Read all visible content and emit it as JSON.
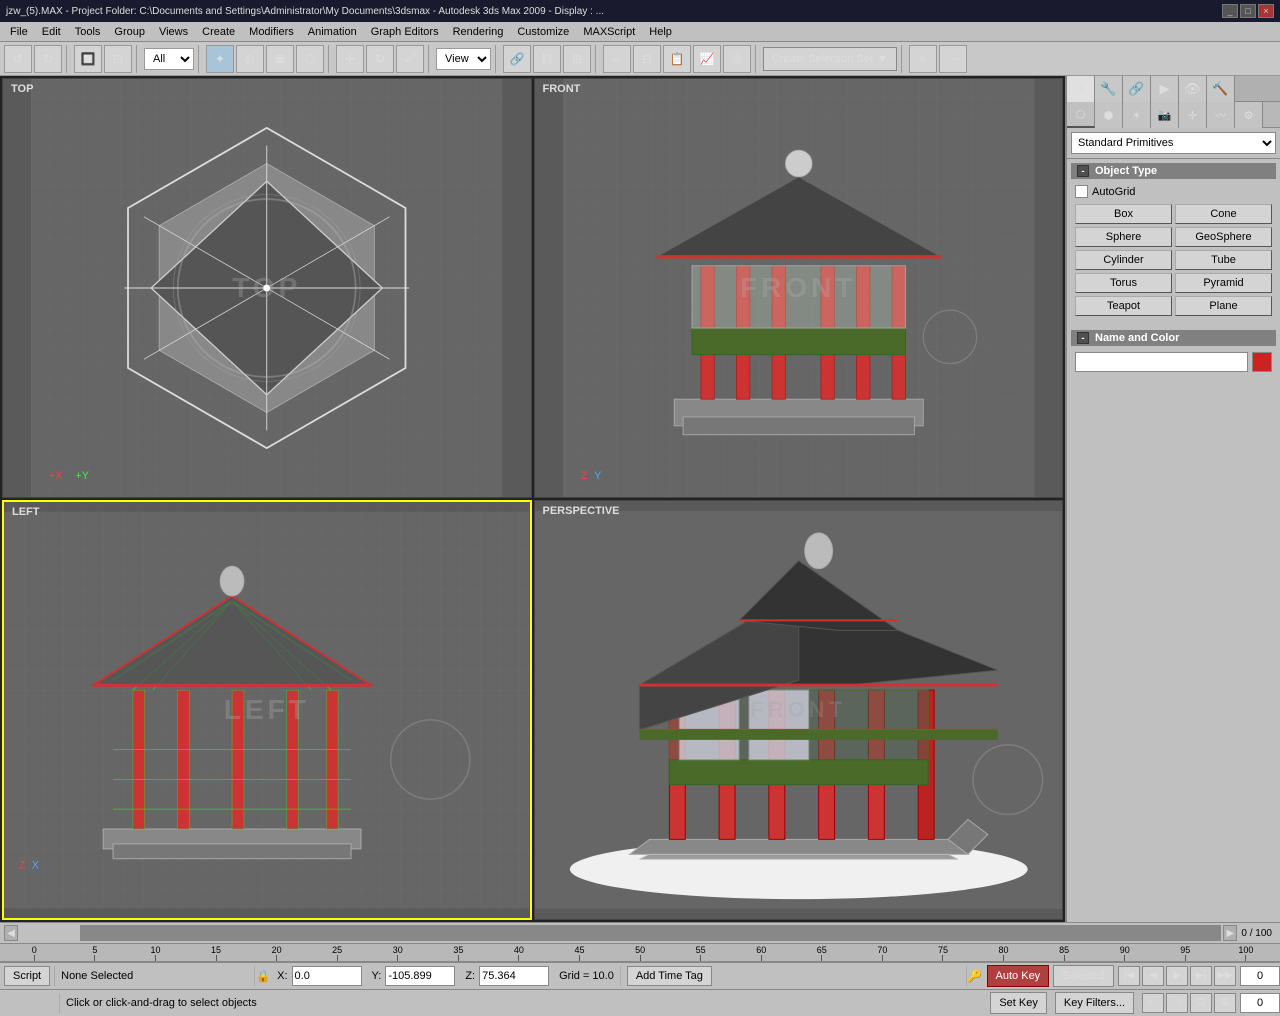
{
  "titlebar": {
    "text": "jzw_(5).MAX - Project Folder: C:\\Documents and Settings\\Administrator\\My Documents\\3dsmax - Autodesk 3ds Max 2009 - Display : ...",
    "win_buttons": [
      "_",
      "□",
      "×"
    ]
  },
  "menubar": {
    "items": [
      "File",
      "Edit",
      "Tools",
      "Group",
      "Views",
      "Create",
      "Modifiers",
      "Animation",
      "Graph Editors",
      "Rendering",
      "Customize",
      "MAXScript",
      "Help"
    ]
  },
  "toolbar": {
    "create_selection_label": "Create Selection Set",
    "filter_label": "All"
  },
  "viewports": [
    {
      "id": "top",
      "label": "Top",
      "watermark": "TOP",
      "active": false
    },
    {
      "id": "front",
      "label": "Front",
      "watermark": "FRONT",
      "active": false
    },
    {
      "id": "left",
      "label": "Left",
      "watermark": "LEFT",
      "active": true
    },
    {
      "id": "perspective",
      "label": "Perspective",
      "watermark": "FRONT",
      "active": false
    }
  ],
  "right_panel": {
    "dropdown_label": "Standard Primitives",
    "object_type_header": "Object Type",
    "autogrid_label": "AutoGrid",
    "buttons": [
      "Box",
      "Cone",
      "Sphere",
      "GeoSphere",
      "Cylinder",
      "Tube",
      "Torus",
      "Pyramid",
      "Teapot",
      "Plane"
    ],
    "name_color_header": "Name and Color",
    "name_placeholder": ""
  },
  "timeline": {
    "progress_label": "0 / 100"
  },
  "ruler": {
    "marks": [
      "0",
      "5",
      "10",
      "15",
      "20",
      "25",
      "30",
      "35",
      "40",
      "45",
      "50",
      "55",
      "60",
      "65",
      "70",
      "75",
      "80",
      "85",
      "90",
      "95",
      "100"
    ]
  },
  "statusbar": {
    "none_selected": "None Selected",
    "x_label": "X:",
    "x_value": "0.0",
    "y_label": "Y:",
    "y_value": "-105.899",
    "z_label": "Z:",
    "z_value": "75.364",
    "grid_label": "Grid = 10.0",
    "auto_key_label": "Auto Key",
    "selected_label": "Selected",
    "set_key_label": "Set Key",
    "key_filters_label": "Key Filters...",
    "frame_value": "0",
    "script_label": "Script",
    "hint_text": "Click or click-and-drag to select objects"
  }
}
